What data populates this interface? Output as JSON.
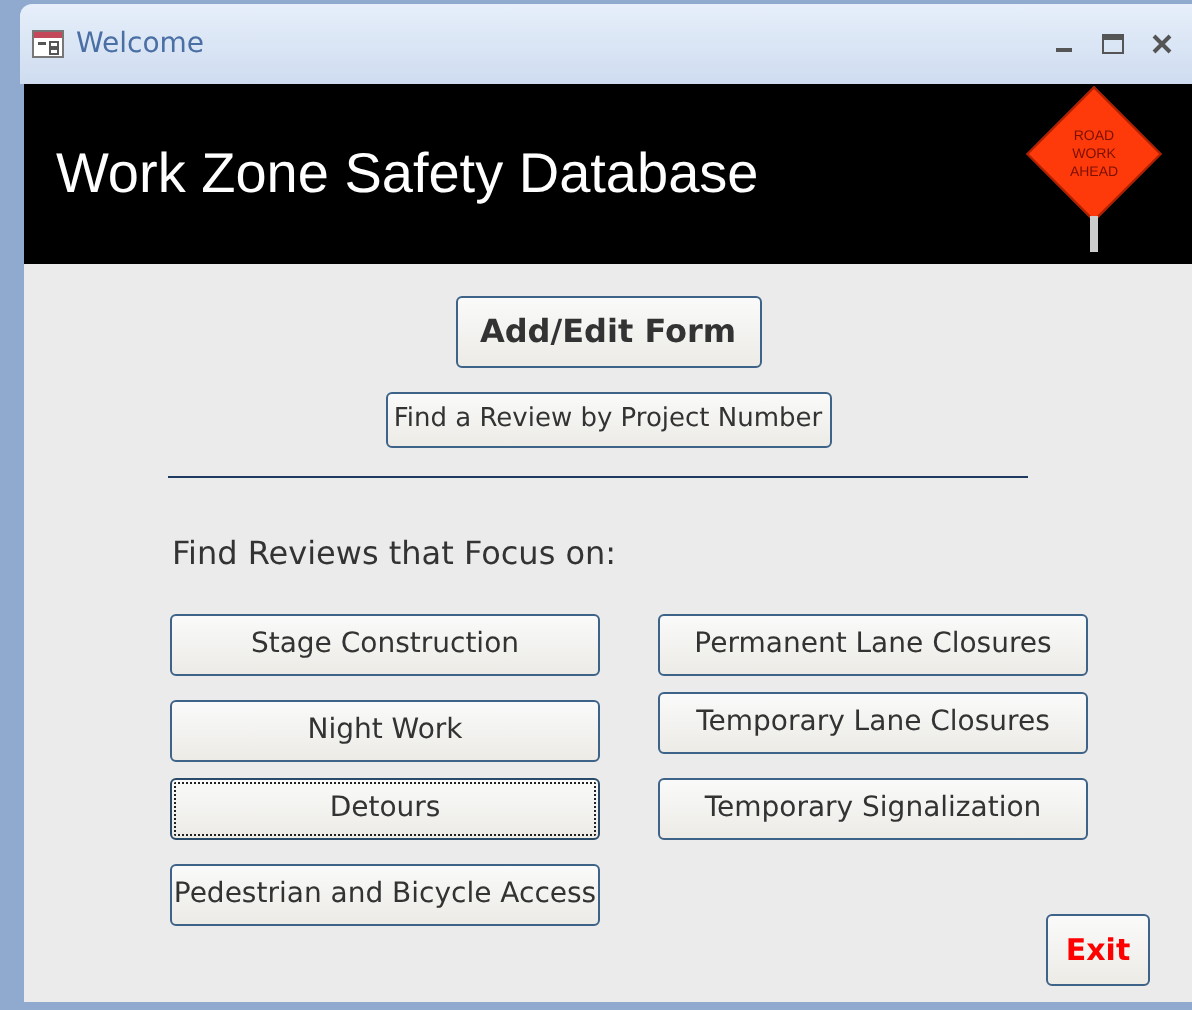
{
  "window": {
    "title": "Welcome"
  },
  "header": {
    "title": "Work Zone Safety Database",
    "sign_lines": [
      "ROAD",
      "WORK",
      "AHEAD"
    ]
  },
  "main_buttons": [
    {
      "label": "Add/Edit Form",
      "kind": "large"
    },
    {
      "label": "Find a Review by Project Number",
      "kind": "small"
    }
  ],
  "focus_heading": "Find Reviews that Focus on:",
  "focus_columns": [
    [
      {
        "label": "Stage Construction",
        "focused": false
      },
      {
        "label": "Night Work",
        "focused": false
      },
      {
        "label": "Detours",
        "focused": true
      },
      {
        "label": "Pedestrian and Bicycle Access",
        "focused": false
      }
    ],
    [
      {
        "label": "Permanent Lane Closures",
        "focused": false
      },
      {
        "label": "Temporary Lane Closures",
        "focused": false
      },
      {
        "label": "Temporary Signalization",
        "focused": false
      }
    ]
  ],
  "exit_button": {
    "label": "Exit"
  }
}
